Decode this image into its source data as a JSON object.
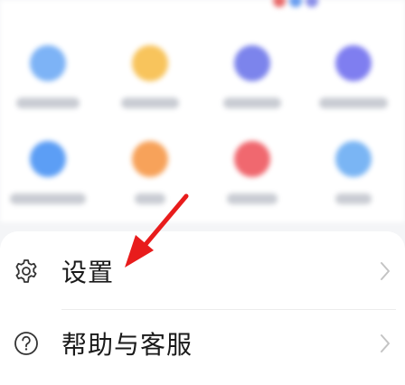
{
  "menu": {
    "items": [
      {
        "label": "设置",
        "icon": "gear-icon"
      },
      {
        "label": "帮助与客服",
        "icon": "question-circle-icon"
      }
    ]
  },
  "grid_tiles": [
    {
      "icon_color": "#7db3f6"
    },
    {
      "icon_color": "#f8c45c"
    },
    {
      "icon_color": "#7c84ec"
    },
    {
      "icon_color": "#7f7ef0"
    },
    {
      "icon_color": "#5c9ef5"
    },
    {
      "icon_color": "#f7a25a"
    },
    {
      "icon_color": "#f0686f"
    },
    {
      "icon_color": "#7ab5f4"
    }
  ],
  "colors": {
    "annotation_arrow": "#e81c1c",
    "chevron": "#c4c4c4"
  }
}
